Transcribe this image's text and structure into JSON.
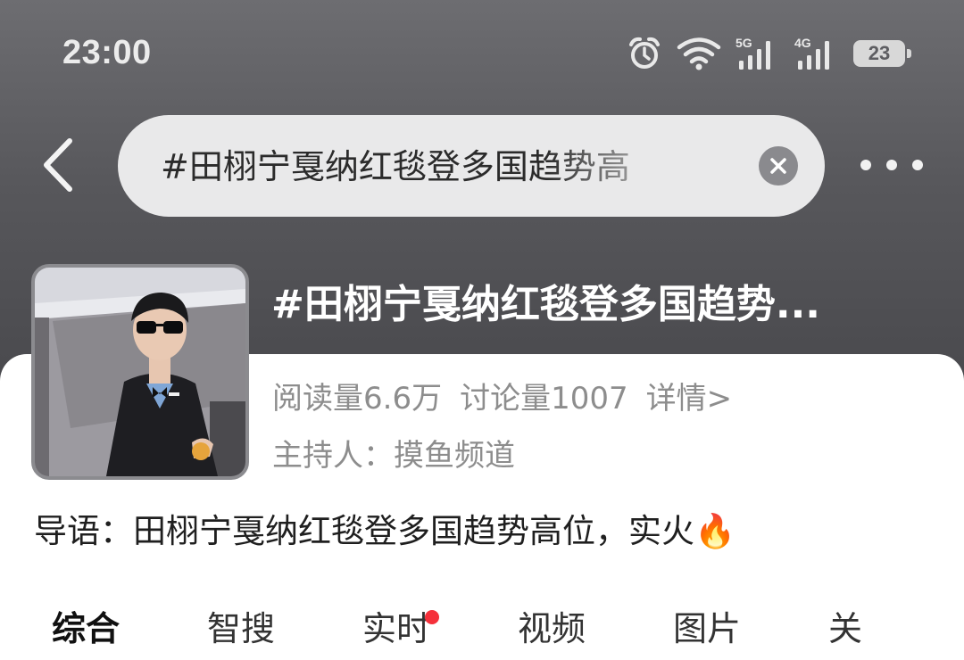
{
  "status_bar": {
    "time": "23:00",
    "icons": [
      "alarm-icon",
      "wifi-icon",
      "signal-5g-icon",
      "signal-4g-icon"
    ],
    "signal_5g_label": "5G",
    "signal_4g_label": "4G",
    "battery": "23"
  },
  "nav": {
    "back_icon": "chevron-left-icon",
    "search_query": "#田栩宁戛纳红毯登多国趋势高",
    "clear_icon": "close-icon",
    "more_icon": "more-dots-icon"
  },
  "topic": {
    "title": "#田栩宁戛纳红毯登多国趋势...",
    "reads": "阅读量6.6万",
    "discussions": "讨论量1007",
    "detail_link": "详情>",
    "host_label": "主持人：",
    "host_name": "摸鱼频道",
    "intro": "导语：田栩宁戛纳红毯登多国趋势高位，实火🔥"
  },
  "tabs": [
    {
      "label": "综合",
      "active": true
    },
    {
      "label": "智搜"
    },
    {
      "label": "实时",
      "dot": true
    },
    {
      "label": "视频"
    },
    {
      "label": "图片"
    },
    {
      "label": "关"
    }
  ],
  "colors": {
    "header_bg": "#5f5f63",
    "search_bg": "#e9e9ea",
    "muted_text": "#8d8d8d",
    "dot_red": "#f5303a"
  }
}
